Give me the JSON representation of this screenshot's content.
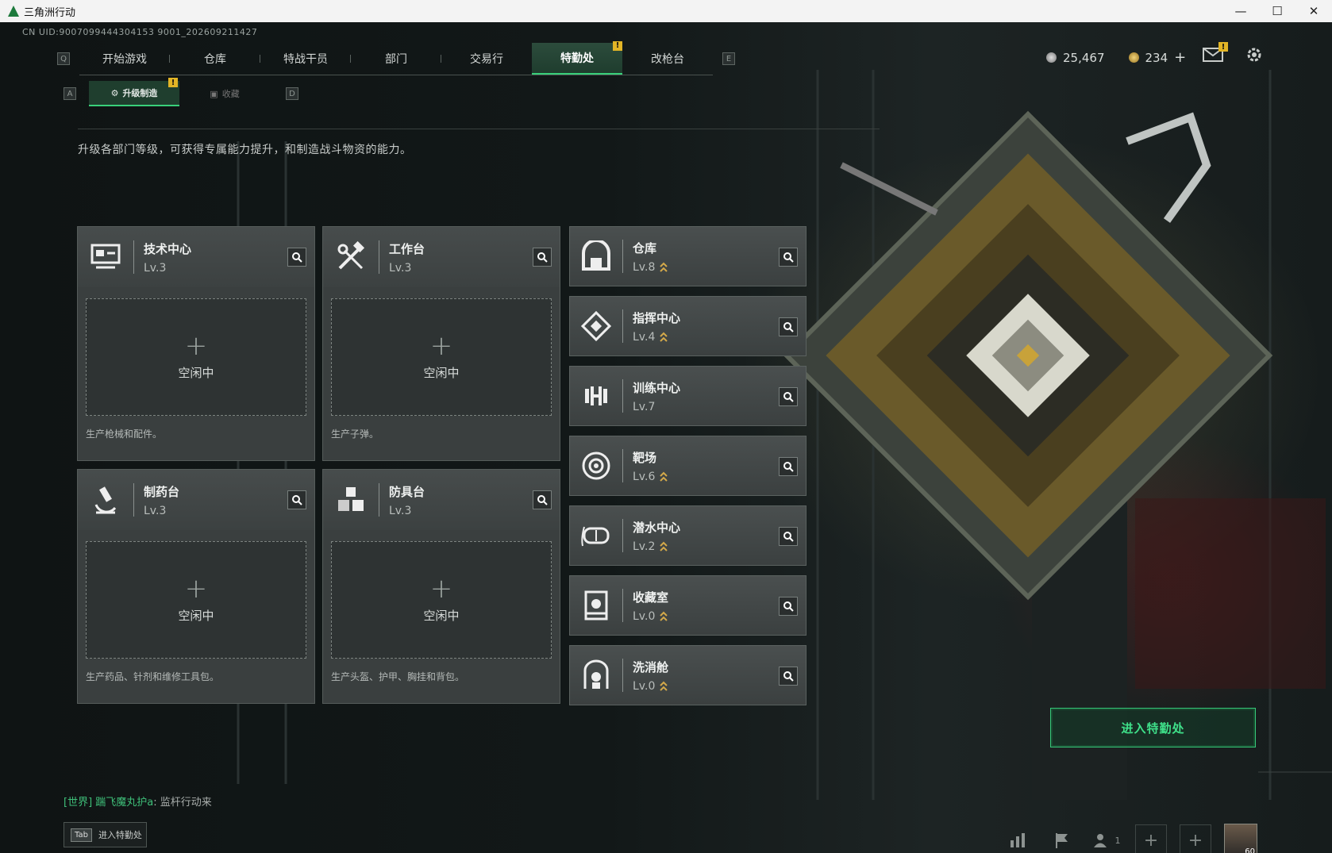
{
  "window": {
    "title": "三角洲行动",
    "controls": [
      "—",
      "☐",
      "✕"
    ]
  },
  "uid": "CN UID:9007099444304153 9001_202609211427",
  "nav": {
    "left_key": "Q",
    "right_key": "E",
    "tabs": [
      "开始游戏",
      "仓库",
      "特战干员",
      "部门",
      "交易行",
      "特勤处",
      "改枪台"
    ],
    "active": "特勤处"
  },
  "currency": {
    "silver": "25,467",
    "gold": "234",
    "plus": "+"
  },
  "subnav": {
    "left_key": "A",
    "right_key": "D",
    "tabs": [
      "升级制造",
      "收藏"
    ]
  },
  "description": "升级各部门等级，可获得专属能力提升，和制造战斗物资的能力。",
  "production": [
    {
      "name": "技术中心",
      "level": "Lv.3",
      "status": "空闲中",
      "desc": "生产枪械和配件。"
    },
    {
      "name": "工作台",
      "level": "Lv.3",
      "status": "空闲中",
      "desc": "生产子弹。"
    },
    {
      "name": "制药台",
      "level": "Lv.3",
      "status": "空闲中",
      "desc": "生产药品、针剂和维修工具包。"
    },
    {
      "name": "防具台",
      "level": "Lv.3",
      "status": "空闲中",
      "desc": "生产头盔、护甲、胸挂和背包。"
    }
  ],
  "facilities": [
    {
      "name": "仓库",
      "level": "Lv.8",
      "upgrade": true
    },
    {
      "name": "指挥中心",
      "level": "Lv.4",
      "upgrade": true
    },
    {
      "name": "训练中心",
      "level": "Lv.7",
      "upgrade": false
    },
    {
      "name": "靶场",
      "level": "Lv.6",
      "upgrade": true
    },
    {
      "name": "潜水中心",
      "level": "Lv.2",
      "upgrade": true
    },
    {
      "name": "收藏室",
      "level": "Lv.0",
      "upgrade": true
    },
    {
      "name": "洗消舱",
      "level": "Lv.0",
      "upgrade": true
    }
  ],
  "enter_button": "进入特勤处",
  "chat": {
    "channel": "[世界]",
    "user": "踹飞魔丸护a",
    "message": ": 监杆行动来"
  },
  "tab_hint": {
    "key": "Tab",
    "label": "进入特勤处"
  },
  "bottom": {
    "friends_count": "1",
    "avatar_level": "60"
  },
  "colors": {
    "accent": "#39d07a",
    "alert": "#e2b526",
    "panel": "#3a3f3f"
  }
}
